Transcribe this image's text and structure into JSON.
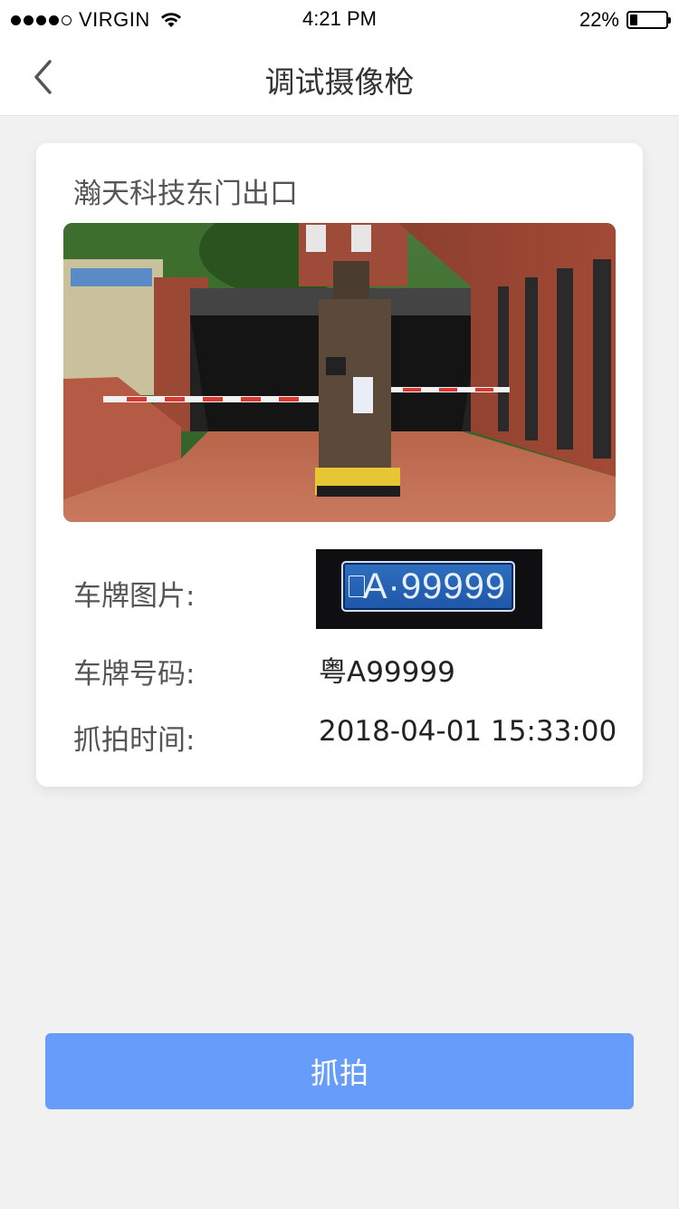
{
  "status_bar": {
    "carrier": "VIRGIN",
    "time": "4:21 PM",
    "battery_percent_text": "22%",
    "battery_level": 0.22,
    "signal_strength": 4,
    "signal_max": 5
  },
  "nav": {
    "title": "调试摄像枪",
    "back_icon": "chevron-left-icon"
  },
  "card": {
    "camera_name": "瀚天科技东门出口",
    "snapshot_icon": "parking-gate-photo",
    "plate_image_label": "车牌图片:",
    "plate_image_text": "A·99999",
    "plate_number_label": "车牌号码:",
    "plate_number_value": "粤A99999",
    "capture_time_label": "抓拍时间:",
    "capture_time_value": "2018-04-01 15:33:00"
  },
  "actions": {
    "capture_label": "抓拍"
  },
  "colors": {
    "primary_button": "#679cfb",
    "background": "#f1f1f1",
    "card": "#ffffff"
  }
}
